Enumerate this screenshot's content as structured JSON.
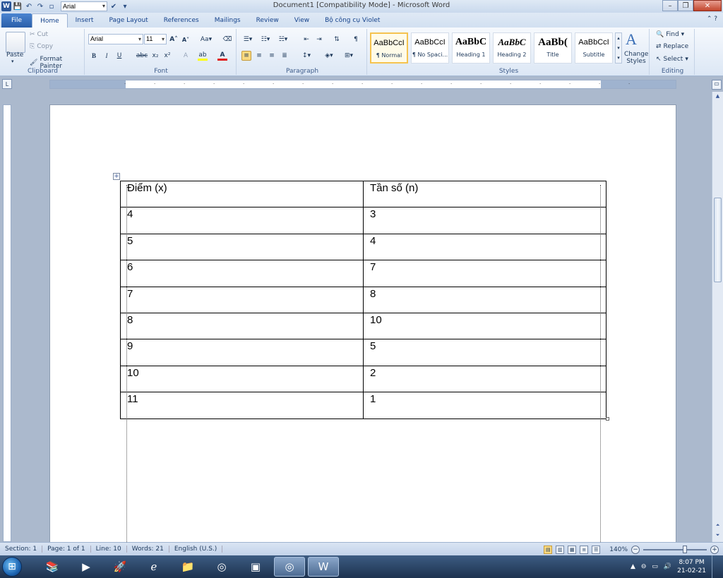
{
  "window": {
    "title": "Document1 [Compatibility Mode] - Microsoft Word"
  },
  "quick_access": {
    "font_name": "Arial"
  },
  "tabs": [
    {
      "label": "File"
    },
    {
      "label": "Home"
    },
    {
      "label": "Insert"
    },
    {
      "label": "Page Layout"
    },
    {
      "label": "References"
    },
    {
      "label": "Mailings"
    },
    {
      "label": "Review"
    },
    {
      "label": "View"
    },
    {
      "label": "Bộ công cụ Violet"
    }
  ],
  "ribbon": {
    "clipboard": {
      "paste": "Paste",
      "cut": "Cut",
      "copy": "Copy",
      "format_painter": "Format Painter",
      "label": "Clipboard"
    },
    "font": {
      "name": "Arial",
      "size": "11",
      "label": "Font"
    },
    "paragraph": {
      "label": "Paragraph"
    },
    "styles": {
      "items": [
        {
          "preview": "AaBbCcI",
          "name": "¶ Normal"
        },
        {
          "preview": "AaBbCcI",
          "name": "¶ No Spaci..."
        },
        {
          "preview": "AaBbC",
          "name": "Heading 1"
        },
        {
          "preview": "AaBbC",
          "name": "Heading 2"
        },
        {
          "preview": "AaBb(",
          "name": "Title"
        },
        {
          "preview": "AaBbCcI",
          "name": "Subtitle"
        }
      ],
      "change_styles": "Change Styles",
      "label": "Styles"
    },
    "editing": {
      "find": "Find",
      "replace": "Replace",
      "select": "Select",
      "label": "Editing"
    }
  },
  "table": {
    "headers": [
      "Điểm (x)",
      "Tần số (n)"
    ],
    "rows": [
      [
        "4",
        "3"
      ],
      [
        "5",
        "4"
      ],
      [
        "6",
        "7"
      ],
      [
        "7",
        "8"
      ],
      [
        "8",
        "10"
      ],
      [
        "9",
        "5"
      ],
      [
        "10",
        "2"
      ],
      [
        "11",
        "1"
      ]
    ]
  },
  "status": {
    "section": "Section: 1",
    "page": "Page: 1 of 1",
    "line": "Line: 10",
    "words": "Words: 21",
    "language": "English (U.S.)",
    "zoom": "140%"
  },
  "taskbar": {
    "time": "8:07 PM",
    "date": "21-02-21"
  }
}
